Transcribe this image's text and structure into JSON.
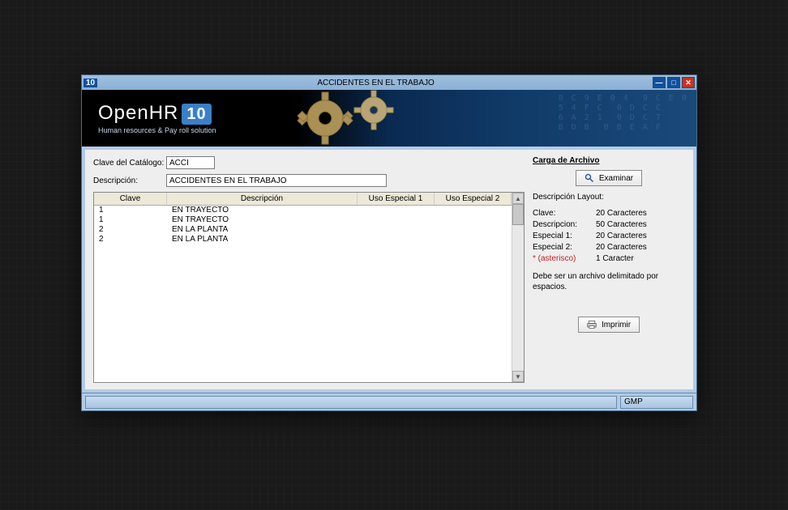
{
  "window": {
    "app_num": "10",
    "title": "ACCIDENTES EN EL TRABAJO"
  },
  "banner": {
    "brand": "OpenHR",
    "version": "10",
    "tagline": "Human resources & Pay roll solution"
  },
  "form": {
    "clave_label": "Clave del Catálogo:",
    "clave_value": "ACCI",
    "desc_label": "Descripción:",
    "desc_value": "ACCIDENTES EN EL TRABAJO"
  },
  "grid": {
    "headers": {
      "clave": "Clave",
      "desc": "Descripción",
      "e1": "Uso Especial 1",
      "e2": "Uso Especial 2"
    },
    "rows": [
      {
        "clave": "1",
        "desc": "EN TRAYECTO",
        "e1": "",
        "e2": ""
      },
      {
        "clave": "1",
        "desc": "EN TRAYECTO",
        "e1": "",
        "e2": ""
      },
      {
        "clave": "2",
        "desc": "EN LA PLANTA",
        "e1": "",
        "e2": ""
      },
      {
        "clave": "2",
        "desc": "EN LA PLANTA",
        "e1": "",
        "e2": ""
      }
    ]
  },
  "right": {
    "carga_title": "Carga de Archivo",
    "examinar": "Examinar",
    "layout_title": "Descripción Layout:",
    "layout": [
      {
        "k": "Clave:",
        "v": "20 Caracteres"
      },
      {
        "k": "Descripcion:",
        "v": "50 Caracteres"
      },
      {
        "k": "Especial 1:",
        "v": "20 Caracteres"
      },
      {
        "k": "Especial 2:",
        "v": "20 Caracteres"
      }
    ],
    "asterisk_k": "* (asterisco)",
    "asterisk_v": "1 Caracter",
    "hint": "Debe ser un archivo delimitado por espacios.",
    "imprimir": "Imprimir"
  },
  "status": {
    "right": "GMP"
  }
}
